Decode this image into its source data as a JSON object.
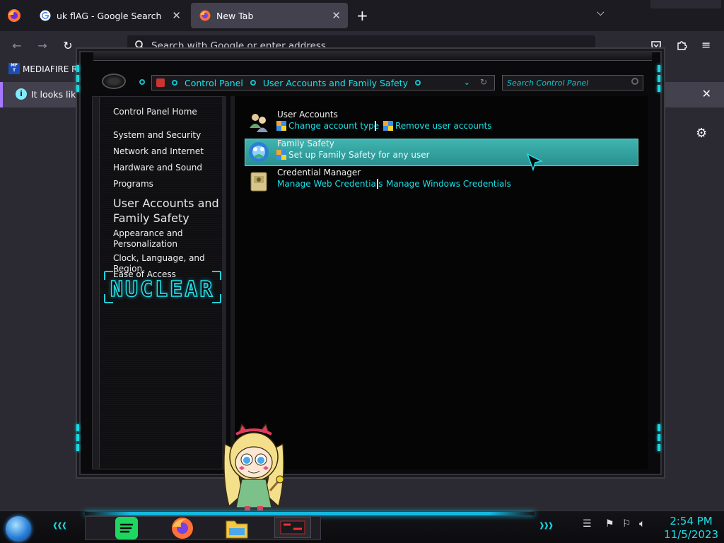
{
  "browser": {
    "tabs": [
      {
        "title": "uk flAG - Google Search",
        "favicon": "google-g-icon",
        "active": false
      },
      {
        "title": "New Tab",
        "favicon": "firefox-icon",
        "active": true
      }
    ],
    "urlbar_placeholder": "Search with Google or enter address",
    "bookmark": {
      "label": "MEDIAFIRE RO",
      "icon_text": "MF T"
    },
    "notification": {
      "text": "It looks like y"
    }
  },
  "control_panel": {
    "breadcrumb": [
      "Control Panel",
      "User Accounts and Family Safety"
    ],
    "search_placeholder": "Search Control Panel",
    "sidebar": {
      "home": "Control Panel Home",
      "items": [
        "System and Security",
        "Network and Internet",
        "Hardware and Sound",
        "Programs",
        "User Accounts and Family Safety",
        "Appearance and Personalization",
        "Clock, Language, and Region",
        "Ease of Access"
      ],
      "items_display": {
        "appearance_line1": "Appearance and",
        "appearance_line2": "Personalization",
        "user_accounts_line1": "User Accounts and",
        "user_accounts_line2": "Family Safety"
      },
      "logo_text": "NUCLEAR"
    },
    "categories": [
      {
        "title": "User Accounts",
        "links": [
          "Change account type",
          "Remove user accounts"
        ]
      },
      {
        "title": "Family Safety",
        "links": [
          "Set up Family Safety for any user"
        ],
        "highlighted": true
      },
      {
        "title": "Credential Manager",
        "links": [
          "Manage Web Credentials",
          "Manage Windows Credentials"
        ]
      }
    ]
  },
  "taskbar": {
    "apps": [
      "spotify-icon",
      "firefox-icon",
      "file-explorer-icon",
      "control-panel-icon"
    ],
    "clock": {
      "time": "2:54 PM",
      "date": "11/5/2023"
    }
  },
  "colors": {
    "accent": "#18e0e8",
    "highlight": "#3fb5b0",
    "browser_bg": "#2b2a33"
  }
}
